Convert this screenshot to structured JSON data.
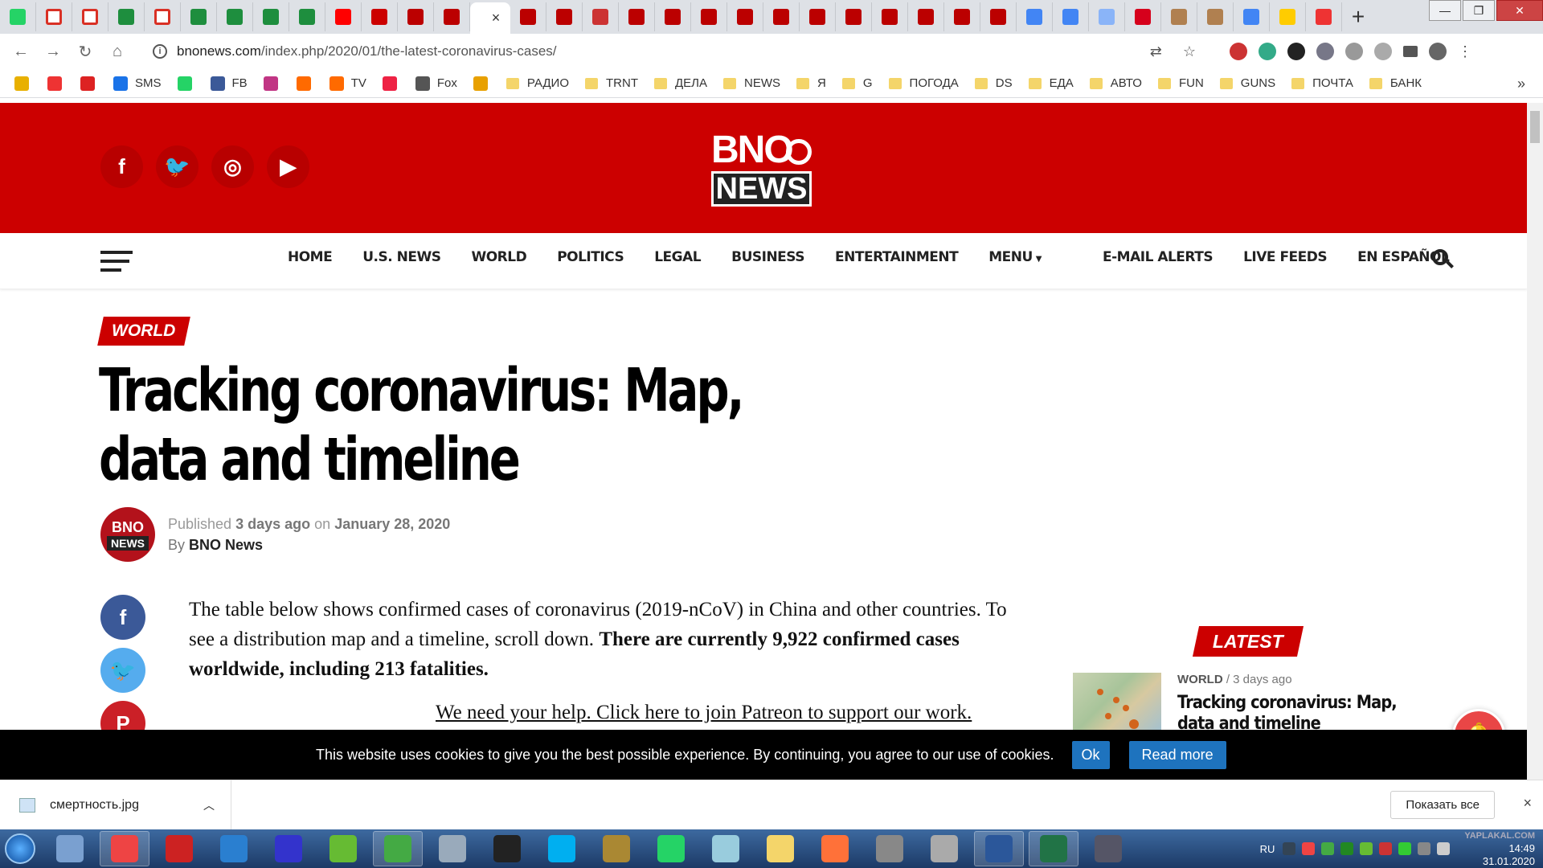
{
  "browser": {
    "tab_favicons": [
      "whatsapp",
      "gmail",
      "gmail",
      "plus-green",
      "gmail",
      "plus-green",
      "plus-green",
      "plus-green",
      "plus-green",
      "youtube",
      "emblem",
      "bno",
      "bno",
      "active",
      "bno",
      "bno",
      "globe-red",
      "bno",
      "bno",
      "bno",
      "bno",
      "bno",
      "bno",
      "bno",
      "bno",
      "bno",
      "bno",
      "bno",
      "apps",
      "apps",
      "star-blue",
      "hh",
      "people",
      "people",
      "apps",
      "yandex-r",
      "red-circle"
    ],
    "active_tab_close": "×",
    "new_tab": "+",
    "url": "bnonews.com",
    "url_path": "/index.php/2020/01/the-latest-coronavirus-cases/",
    "bookmarks": [
      {
        "label": "",
        "icon": "ya"
      },
      {
        "label": "",
        "icon": "red-circle"
      },
      {
        "label": "",
        "icon": "red-triangle"
      },
      {
        "label": "SMS",
        "icon": "sms"
      },
      {
        "label": "",
        "icon": "whatsapp"
      },
      {
        "label": "FB",
        "icon": "facebook"
      },
      {
        "label": "",
        "icon": "instagram"
      },
      {
        "label": "",
        "icon": "bolt"
      },
      {
        "label": "TV",
        "icon": "bolt"
      },
      {
        "label": "",
        "icon": "color-square"
      },
      {
        "label": "Fox",
        "icon": "robot"
      },
      {
        "label": "",
        "icon": "cross"
      },
      {
        "label": "РАДИО",
        "icon": "folder"
      },
      {
        "label": "TRNT",
        "icon": "folder"
      },
      {
        "label": "ДЕЛА",
        "icon": "folder"
      },
      {
        "label": "NEWS",
        "icon": "folder"
      },
      {
        "label": "Я",
        "icon": "folder"
      },
      {
        "label": "G",
        "icon": "folder"
      },
      {
        "label": "ПОГОДА",
        "icon": "folder"
      },
      {
        "label": "DS",
        "icon": "folder"
      },
      {
        "label": "ЕДА",
        "icon": "folder"
      },
      {
        "label": "АВТО",
        "icon": "folder"
      },
      {
        "label": "FUN",
        "icon": "folder"
      },
      {
        "label": "GUNS",
        "icon": "folder"
      },
      {
        "label": "ПОЧТА",
        "icon": "folder"
      },
      {
        "label": "БАНК",
        "icon": "folder"
      }
    ],
    "bookmarks_more": "»"
  },
  "site": {
    "logo_top": "BNO",
    "logo_bottom": "NEWS",
    "nav": [
      "HOME",
      "U.S. NEWS",
      "WORLD",
      "POLITICS",
      "LEGAL",
      "BUSINESS",
      "ENTERTAINMENT",
      "MENU",
      "E-MAIL ALERTS",
      "LIVE FEEDS",
      "EN ESPAÑOL"
    ]
  },
  "article": {
    "category": "WORLD",
    "title": "Tracking coronavirus: Map, data and timeline",
    "author_avatar_top": "BNO",
    "author_avatar_bottom": "NEWS",
    "published_prefix": "Published",
    "published_ago": "3 days ago",
    "published_on": "on",
    "published_date": "January 28, 2020",
    "by": "By",
    "author": "BNO News",
    "body_plain": "The table below shows confirmed cases of coronavirus (2019-nCoV) in China and other countries. To see a distribution map and a timeline, scroll down. ",
    "body_bold": "There are currently 9,922 confirmed cases worldwide, including 213 fatalities.",
    "patreon": "We need your help. Click here to join Patreon to support our work."
  },
  "sidebar": {
    "latest_label": "LATEST",
    "item_category": "WORLD",
    "item_sep": "/",
    "item_ago": "3 days ago",
    "item_title": "Tracking coronavirus: Map, data and timeline"
  },
  "cookie": {
    "text": "This website uses cookies to give you the best possible experience. By continuing, you agree to our use of cookies.",
    "ok": "Ok",
    "read_more": "Read more"
  },
  "downloads": {
    "file": "смертность.jpg",
    "show_all": "Показать все",
    "close": "×"
  },
  "taskbar": {
    "lang": "RU",
    "time": "14:49",
    "date": "31.01.2020",
    "watermark": "YAPLAKAL.COM"
  },
  "colors": {
    "brand_red": "#cc0000",
    "button_blue": "#1e73be"
  }
}
